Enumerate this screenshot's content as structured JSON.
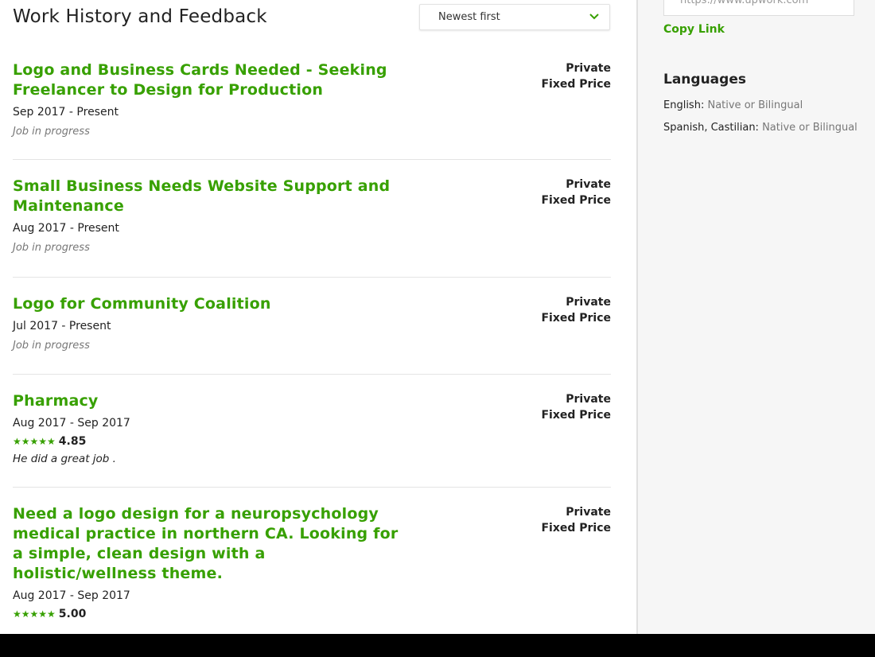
{
  "work_history": {
    "title": "Work History and Feedback",
    "sort": {
      "selected": "Newest first"
    },
    "jobs": [
      {
        "title": "Logo and Business Cards Needed - Seeking Freelancer to Design for Production",
        "dates": "Sep 2017 - Present",
        "status": "Job in progress",
        "visibility": "Private",
        "contract_type": "Fixed Price"
      },
      {
        "title": "Small Business Needs Website Support and Maintenance",
        "dates": "Aug 2017 - Present",
        "status": "Job in progress",
        "visibility": "Private",
        "contract_type": "Fixed Price"
      },
      {
        "title": "Logo for Community Coalition",
        "dates": "Jul 2017 - Present",
        "status": "Job in progress",
        "visibility": "Private",
        "contract_type": "Fixed Price"
      },
      {
        "title": "Pharmacy",
        "dates": "Aug 2017 - Sep 2017",
        "stars": "★★★★★",
        "rating": "4.85",
        "feedback": "He did a great job .",
        "visibility": "Private",
        "contract_type": "Fixed Price"
      },
      {
        "title": "Need a logo design for a neuropsychology medical practice in northern CA. Looking for a simple, clean design with a holistic/wellness theme.",
        "dates": "Aug 2017 - Sep 2017",
        "stars": "★★★★★",
        "rating": "5.00",
        "visibility": "Private",
        "contract_type": "Fixed Price"
      }
    ]
  },
  "sidebar": {
    "profile_url": "https://www.upwork.com",
    "copy_link_label": "Copy Link",
    "languages_heading": "Languages",
    "languages": [
      {
        "name": "English:",
        "level": "Native or Bilingual"
      },
      {
        "name": "Spanish, Castilian:",
        "level": "Native or Bilingual"
      }
    ]
  },
  "icons": {
    "sort_chevron": "chevron-down-icon",
    "rating_stars": "star-icon"
  },
  "colors": {
    "accent_green": "#37a000",
    "sidebar_bg": "#f6f6f6"
  }
}
